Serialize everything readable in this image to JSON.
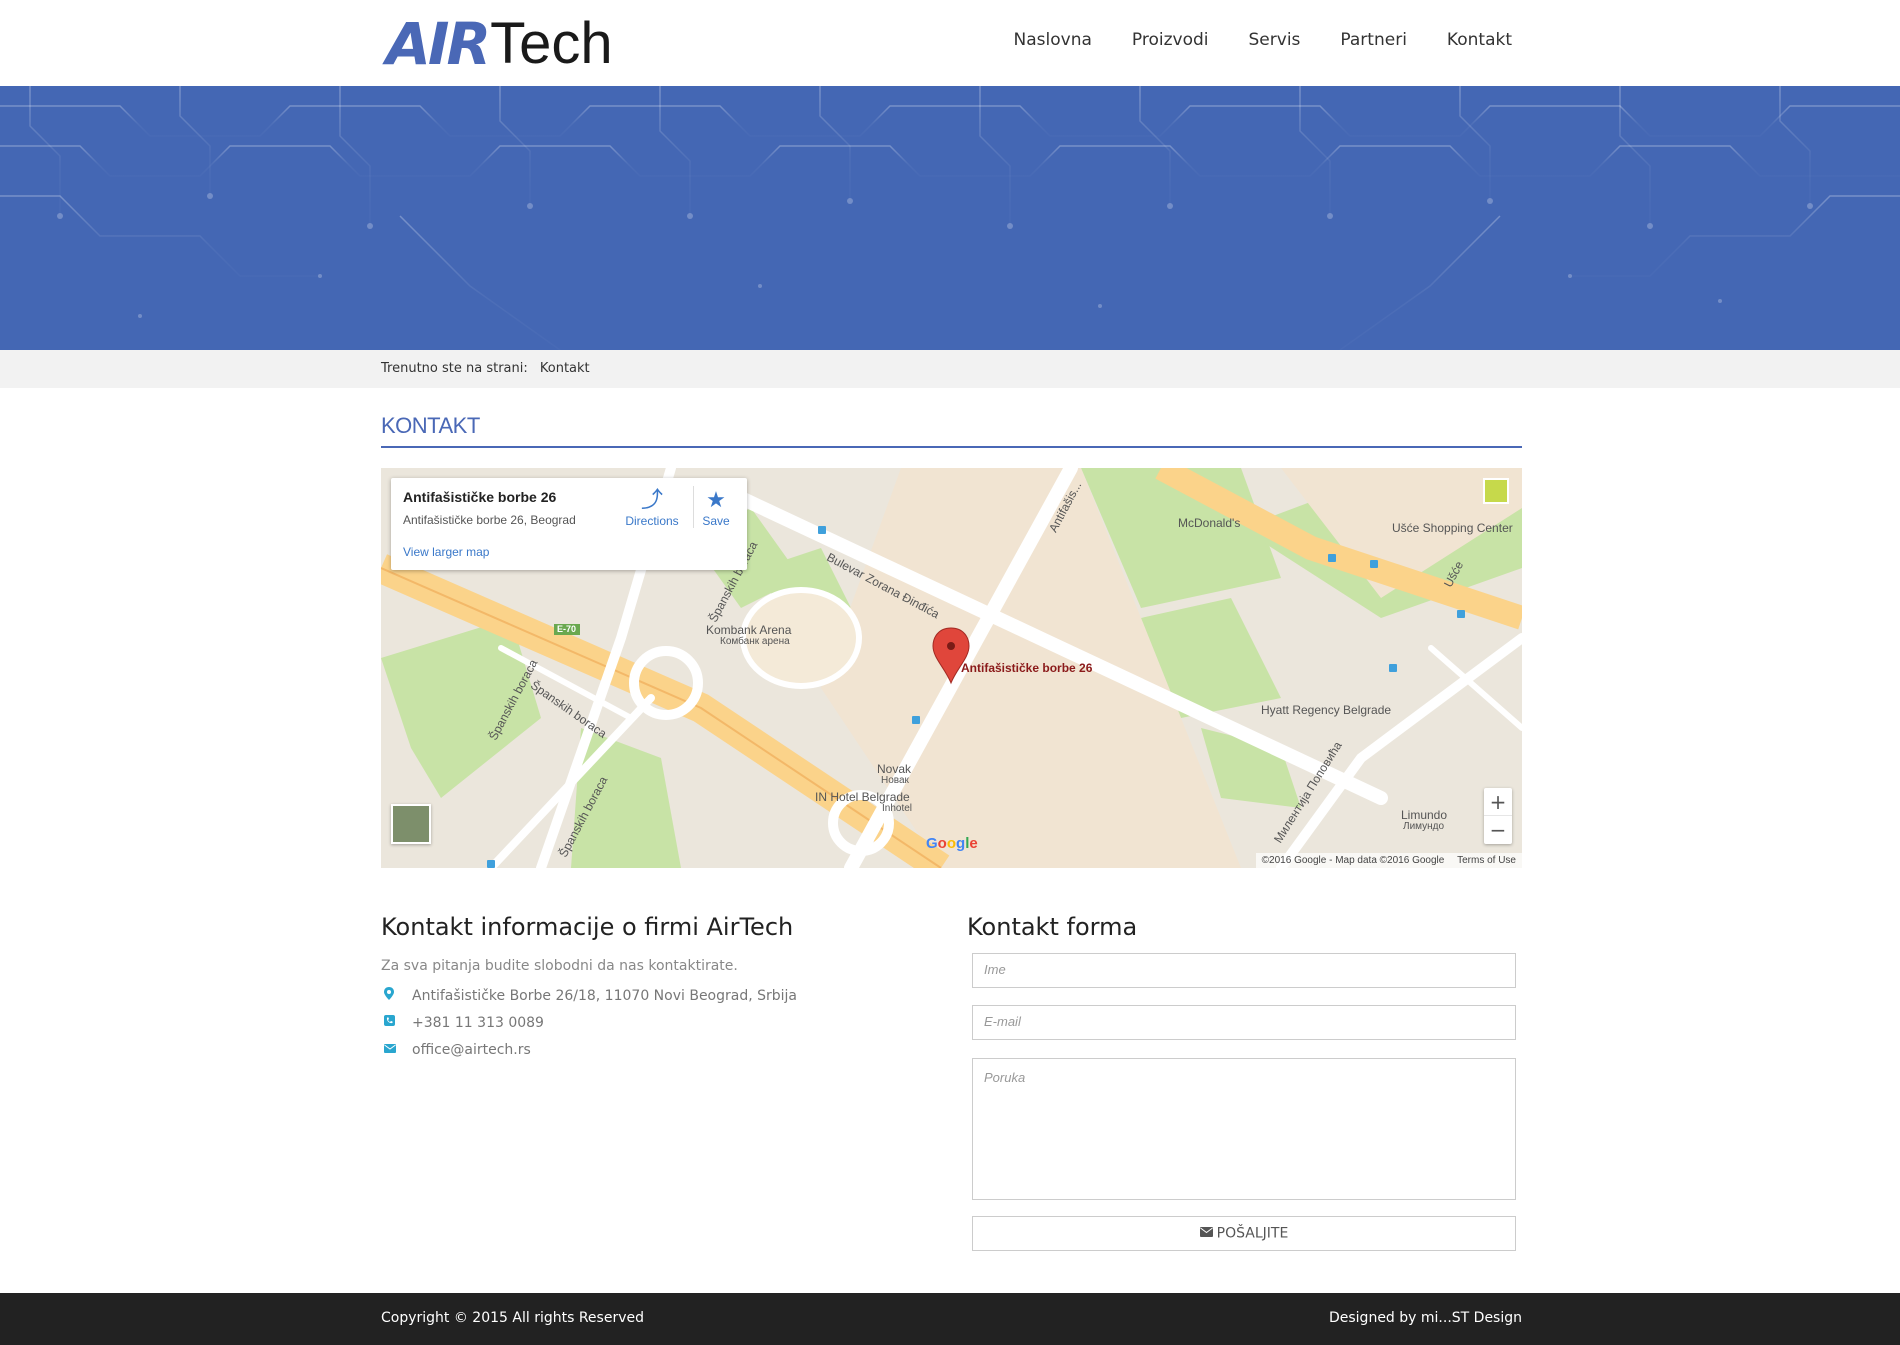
{
  "header": {
    "logo_air": "AIR",
    "logo_tech": "Tech",
    "nav": [
      "Naslovna",
      "Proizvodi",
      "Servis",
      "Partneri",
      "Kontakt"
    ]
  },
  "breadcrumb": {
    "prefix": "Trenutno ste na strani:",
    "current": "Kontakt"
  },
  "page_title": "KONTAKT",
  "map": {
    "card_title": "Antifašističke borbe 26",
    "card_address": "Antifašističke borbe 26, Beograd",
    "view_larger": "View larger map",
    "directions": "Directions",
    "save": "Save",
    "pin_label": "Antifašističke borbe 26",
    "labels": {
      "mcdonalds": "McDonald's",
      "usce": "Ušće Shopping Center",
      "kombank": "Kombank Arena",
      "kombank_cyr": "Комбанк арена",
      "hyatt": "Hyatt Regency Belgrade",
      "novak": "Novak",
      "novak_cyr": "Новак",
      "inhotel": "IN Hotel Belgrade",
      "inhotel2": "Inhotel",
      "limundo": "Limundo",
      "limundo_cyr": "Лимундо",
      "bulevar": "Bulevar Zorana Đinđića",
      "spanskih1": "Španskih boraca",
      "spanskih2": "Španskih boraca",
      "spanskih3": "Španskih boraca",
      "spanskih4": "Španskih boraca",
      "antifas": "Antifašis...",
      "milentija": "Милентија Поповића",
      "usce_road": "Ušće",
      "e70": "E-70"
    },
    "google": "Google",
    "attribution": "©2016 Google - Map data ©2016 Google",
    "terms": "Terms of Use",
    "zoom_in": "+",
    "zoom_out": "−"
  },
  "info": {
    "title": "Kontakt informacije o firmi AirTech",
    "subtitle": "Za sva pitanja budite slobodni da nas kontaktirate.",
    "address": "Antifašističke Borbe 26/18, 11070 Novi Beograd, Srbija",
    "phone": "+381 11 313 0089",
    "email": "office@airtech.rs"
  },
  "form": {
    "title": "Kontakt forma",
    "name_placeholder": "Ime",
    "email_placeholder": "E-mail",
    "message_placeholder": "Poruka",
    "submit": "POŠALJITE"
  },
  "footer": {
    "copyright": "Copyright © 2015 All rights Reserved",
    "designer": "Designed by mi...ST Design"
  },
  "colors": {
    "brand_blue": "#4a68b6",
    "banner": "#4467b4",
    "footer": "#222222",
    "icon_cyan": "#29a6cf"
  }
}
